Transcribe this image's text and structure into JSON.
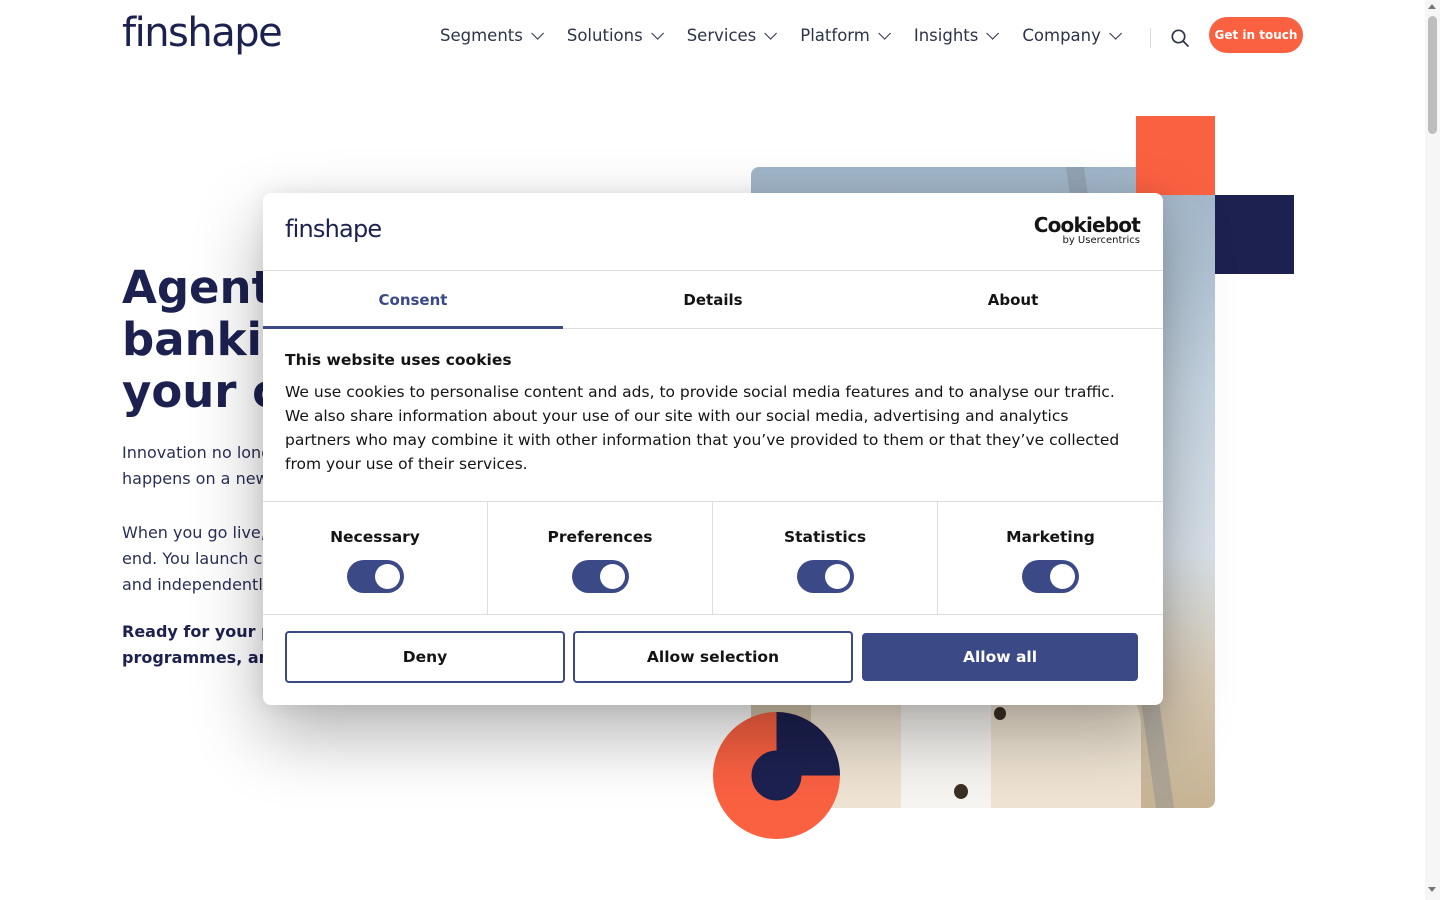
{
  "header": {
    "logo": "finshape",
    "nav": [
      {
        "label": "Segments"
      },
      {
        "label": "Solutions"
      },
      {
        "label": "Services"
      },
      {
        "label": "Platform"
      },
      {
        "label": "Insights"
      },
      {
        "label": "Company"
      }
    ],
    "search_icon": "search-icon",
    "cta_label": "Get in touch"
  },
  "hero": {
    "title": "Agenti\nbankir\nyour c",
    "p1": "Innovation no long\nhappens on a new",
    "p2": "When you go live,\nend. You launch c\nand independentl",
    "p3": "Ready for your pr\nprogrammes, and"
  },
  "colors": {
    "brand_navy": "#1c2150",
    "brand_orange": "#fa6141",
    "cookie_accent": "#3b4a87"
  },
  "cookie": {
    "logo": "finshape",
    "brand_name": "Cookiebot",
    "brand_sub": "by Usercentrics",
    "tabs": [
      {
        "label": "Consent",
        "active": true
      },
      {
        "label": "Details",
        "active": false
      },
      {
        "label": "About",
        "active": false
      }
    ],
    "heading": "This website uses cookies",
    "body": "We use cookies to personalise content and ads, to provide social media features and to analyse our traffic. We also share information about your use of our site with our social media, advertising and analytics partners who may combine it with other information that you’ve provided to them or that they’ve collected from your use of their services.",
    "toggles": [
      {
        "label": "Necessary",
        "on": true
      },
      {
        "label": "Preferences",
        "on": true
      },
      {
        "label": "Statistics",
        "on": true
      },
      {
        "label": "Marketing",
        "on": true
      }
    ],
    "buttons": {
      "deny": "Deny",
      "allow_selection": "Allow selection",
      "allow_all": "Allow all"
    }
  }
}
